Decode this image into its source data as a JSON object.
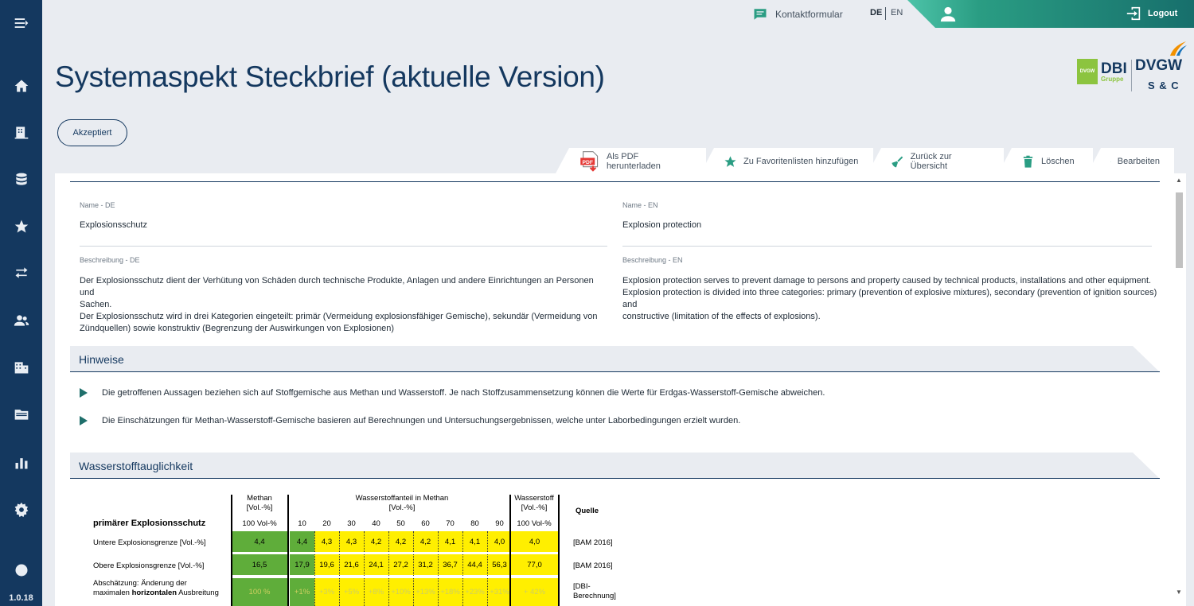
{
  "app": {
    "version": "1.0.18"
  },
  "sidebar": {
    "items": [
      {
        "name": "menu-icon"
      },
      {
        "name": "home-icon"
      },
      {
        "name": "building-icon"
      },
      {
        "name": "database-icon"
      },
      {
        "name": "star-icon"
      },
      {
        "name": "transfer-icon"
      },
      {
        "name": "users-icon"
      },
      {
        "name": "office-icon"
      },
      {
        "name": "folder-icon"
      },
      {
        "name": "chart-icon"
      },
      {
        "name": "settings-icon"
      },
      {
        "name": "info-icon"
      }
    ]
  },
  "topbar": {
    "contact_label": "Kontaktformular",
    "lang_de": "DE",
    "lang_en": "EN",
    "logout_label": "Logout"
  },
  "page": {
    "title": "Systemaspekt Steckbrief (aktuelle Version)",
    "status_label": "Akzeptiert"
  },
  "logos": {
    "dbi_main": "DBI",
    "dbi_sub": "Gruppe",
    "dbi_badge": "DVGW",
    "dvgw_main": "DVGW",
    "dvgw_sub": "S & C"
  },
  "actions": {
    "pdf": "Als PDF herunterladen",
    "favorites": "Zu Favoritenlisten hinzufügen",
    "back": "Zurück zur Übersicht",
    "delete": "Löschen",
    "edit": "Bearbeiten"
  },
  "fields": {
    "name_de_label": "Name - DE",
    "name_de_value": "Explosionsschutz",
    "name_en_label": "Name - EN",
    "name_en_value": "Explosion protection",
    "desc_de_label": "Beschreibung - DE",
    "desc_de_line1": "Der Explosionsschutz dient der Verhütung von Schäden durch technische Produkte, Anlagen und andere Einrichtungen an Personen und",
    "desc_de_line2": "Sachen.",
    "desc_de_line3": "Der Explosionsschutz wird in drei Kategorien eingeteilt: primär (Vermeidung explosionsfähiger Gemische), sekundär (Vermeidung von",
    "desc_de_line4": "Zündquellen) sowie konstruktiv (Begrenzung der Auswirkungen von Explosionen)",
    "desc_en_label": "Beschreibung - EN",
    "desc_en_line1": "Explosion protection serves to prevent damage to persons and property caused by technical products, installations and other equipment.",
    "desc_en_line2": "Explosion protection is divided into three categories: primary (prevention of explosive mixtures), secondary (prevention of ignition sources) and",
    "desc_en_line3": "constructive (limitation of the effects of explosions)."
  },
  "hinweise": {
    "title": "Hinweise",
    "notes": [
      "Die getroffenen Aussagen beziehen sich auf Stoffgemische aus Methan und Wasserstoff. Je nach Stoffzusammensetzung können die Werte für Erdgas-Wasserstoff-Gemische abweichen.",
      "Die Einschätzungen für Methan-Wasserstoff-Gemische basieren auf Berechnungen und Untersuchungsergebnissen, welche unter Laborbedingungen erzielt wurden."
    ]
  },
  "wasserstoff": {
    "title": "Wasserstofftauglichkeit",
    "table": {
      "col_methan_1": "Methan",
      "col_methan_2": "[Vol.-%]",
      "col_mix_1": "Wasserstoffanteil in Methan",
      "col_mix_2": "[Vol.-%]",
      "col_h2_1": "Wasserstoff",
      "col_h2_2": "[Vol.-%]",
      "col_source": "Quelle",
      "row_group": "primärer Explosionsschutz",
      "methan_pct": "100 Vol-%",
      "h2_pct": "100 Vol-%",
      "mix_pcts": [
        "10",
        "20",
        "30",
        "40",
        "50",
        "60",
        "70",
        "80",
        "90"
      ],
      "rows": [
        {
          "label": "Untere Explosionsgrenze [Vol.-%]",
          "methan": "4,4",
          "mix": [
            "4,4",
            "4,3",
            "4,3",
            "4,2",
            "4,2",
            "4,2",
            "4,1",
            "4,1",
            "4,0"
          ],
          "h2": "4,0",
          "source": "[BAM 2016]"
        },
        {
          "label": "Obere Explosionsgrenze [Vol.-%]",
          "methan": "16,5",
          "mix": [
            "17,9",
            "19,6",
            "21,6",
            "24,1",
            "27,2",
            "31,2",
            "36,7",
            "44,4",
            "56,3"
          ],
          "h2": "77,0",
          "source": "[BAM 2016]"
        },
        {
          "label_1": "Abschätzung: Änderung der",
          "label_2": "maximalen ",
          "label_bold": "horizontalen",
          "label_3": " Ausbreitung",
          "methan": "100 %",
          "mix": [
            "+1%",
            "+3%",
            "+5%",
            "+8%",
            "+10%",
            "+13%",
            "+18%",
            "+23%",
            "+31%"
          ],
          "h2": "+ 42%",
          "source_1": "[DBI-",
          "source_2": "Berechnung]"
        }
      ]
    }
  },
  "colors": {
    "sidebar": "#14385f",
    "accent": "#2a9d83",
    "green_cell": "#5fad3a",
    "yellow_cell": "#ffef00"
  }
}
